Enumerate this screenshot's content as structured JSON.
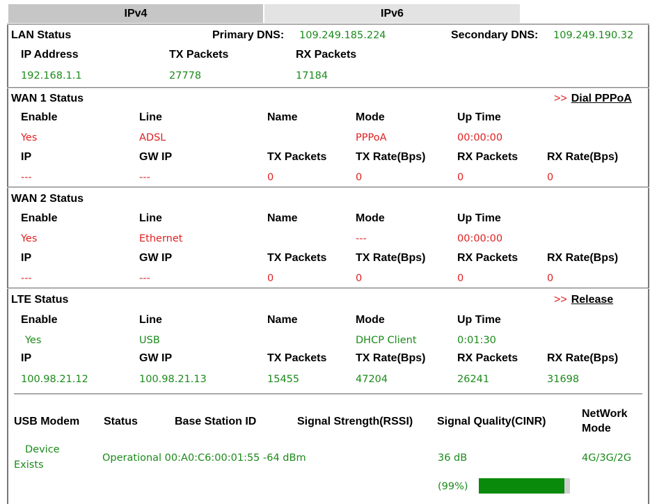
{
  "tabs": [
    {
      "label": "IPv4",
      "active": true
    },
    {
      "label": "IPv6",
      "active": false
    }
  ],
  "lan": {
    "title": "LAN Status",
    "primary_dns_label": "Primary DNS:",
    "primary_dns": "109.249.185.224",
    "secondary_dns_label": "Secondary DNS:",
    "secondary_dns": "109.249.190.32",
    "headers": [
      "IP Address",
      "TX Packets",
      "RX Packets"
    ],
    "values": [
      "192.168.1.1",
      "27778",
      "17184"
    ]
  },
  "wan1": {
    "title": "WAN 1 Status",
    "action_arrow": ">>",
    "action_label": "Dial PPPoA",
    "row1_headers": [
      "Enable",
      "Line",
      "Name",
      "Mode",
      "Up Time"
    ],
    "row1_values": [
      "Yes",
      "ADSL",
      "",
      "PPPoA",
      "00:00:00"
    ],
    "row2_headers": [
      "IP",
      "GW IP",
      "TX Packets",
      "TX Rate(Bps)",
      "RX Packets",
      "RX Rate(Bps)"
    ],
    "row2_values": [
      "---",
      "---",
      "0",
      "0",
      "0",
      "0"
    ]
  },
  "wan2": {
    "title": "WAN 2 Status",
    "row1_headers": [
      "Enable",
      "Line",
      "Name",
      "Mode",
      "Up Time"
    ],
    "row1_values": [
      "Yes",
      "Ethernet",
      "",
      "---",
      "00:00:00"
    ],
    "row2_headers": [
      "IP",
      "GW IP",
      "TX Packets",
      "TX Rate(Bps)",
      "RX Packets",
      "RX Rate(Bps)"
    ],
    "row2_values": [
      "---",
      "---",
      "0",
      "0",
      "0",
      "0"
    ]
  },
  "lte": {
    "title": "LTE Status",
    "action_arrow": ">>",
    "action_label": "Release",
    "row1_headers": [
      "Enable",
      "Line",
      "Name",
      "Mode",
      "Up Time"
    ],
    "row1_values": [
      "Yes",
      "USB",
      "",
      "DHCP Client",
      "0:01:30"
    ],
    "row2_headers": [
      "IP",
      "GW IP",
      "TX Packets",
      "TX Rate(Bps)",
      "RX Packets",
      "RX Rate(Bps)"
    ],
    "row2_values": [
      "100.98.21.12",
      "100.98.21.13",
      "15455",
      "47204",
      "26241",
      "31698"
    ]
  },
  "modem": {
    "headers": [
      "USB Modem",
      "Status",
      "Base Station ID",
      "Signal Strength(RSSI)",
      "Signal Quality(CINR)",
      "NetWork",
      "Mode"
    ],
    "device_line1": "Device",
    "device_line2": "Exists",
    "status_line": "Operational 00:A0:C6:00:01:55 -64 dBm",
    "cinr": "36 dB",
    "network_mode": "4G/3G/2G",
    "quality_pct_text": "(99%)",
    "quality_fraction": 0.99,
    "bar_color": "#0a8a0a"
  }
}
